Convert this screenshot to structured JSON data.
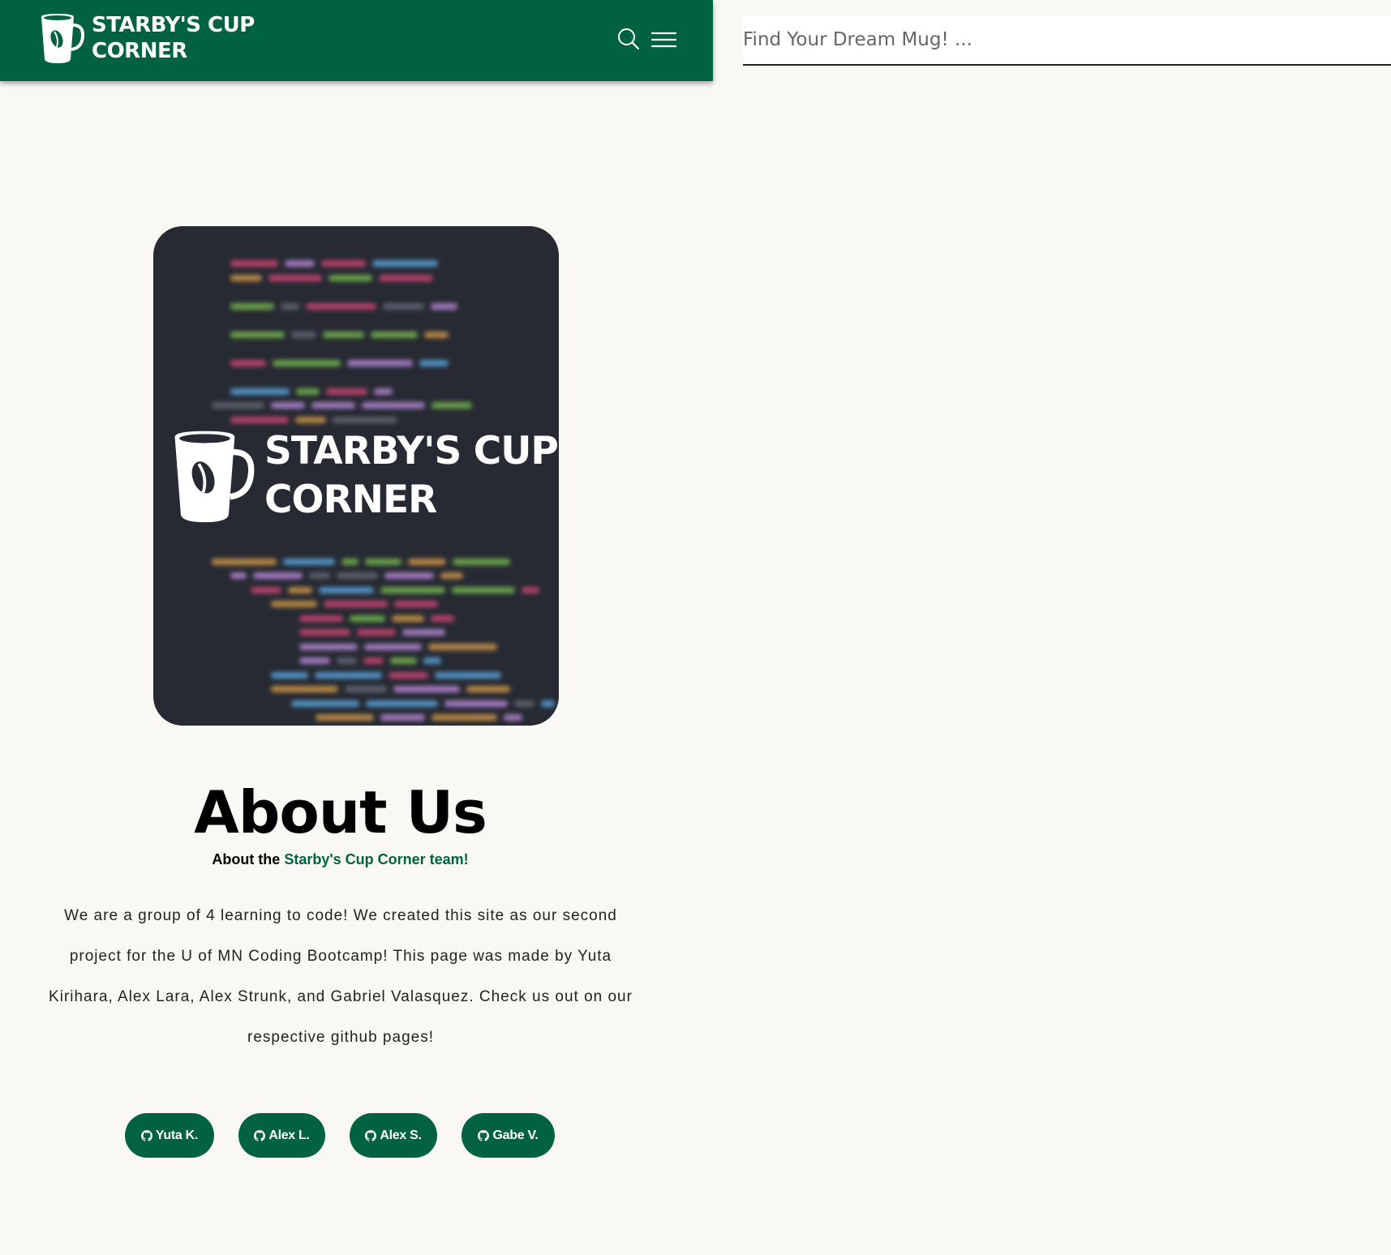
{
  "header": {
    "brand_line1": "STARBY'S CUP",
    "brand_line2": "CORNER"
  },
  "search": {
    "placeholder": "Find Your Dream Mug! ..."
  },
  "hero": {
    "brand_line1": "STARBY'S CUP",
    "brand_line2": "CORNER"
  },
  "about": {
    "title": "About Us",
    "subtitle_prefix": "About the ",
    "subtitle_accent": "Starby's Cup Corner team!",
    "body": "We are a group of 4 learning to code! We created this site as our second project for the U of MN Coding Bootcamp! This page was made by Yuta Kirihara, Alex Lara, Alex Strunk, and Gabriel Valasquez. Check us out on our respective github pages!"
  },
  "team_links": [
    {
      "label": "Yuta K.",
      "icon": "github-icon"
    },
    {
      "label": "Alex L.",
      "icon": "github-icon"
    },
    {
      "label": "Alex S.",
      "icon": "github-icon"
    },
    {
      "label": "Gabe V.",
      "icon": "github-icon"
    }
  ],
  "colors": {
    "brand_green": "#006241",
    "page_background": "#f9f8f5",
    "hero_background": "#272a33"
  }
}
